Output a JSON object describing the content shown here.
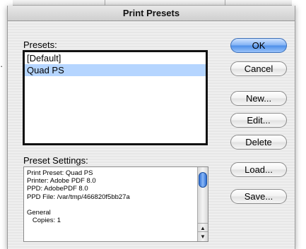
{
  "dialog": {
    "title": "Print Presets"
  },
  "presets": {
    "label": "Presets:",
    "items": [
      {
        "label": "[Default]",
        "selected": false
      },
      {
        "label": "Quad PS",
        "selected": true
      }
    ]
  },
  "settings": {
    "label": "Preset Settings:",
    "lines": [
      "Print Preset: Quad PS",
      "Printer: Adobe PDF 8.0",
      "PPD: AdobePDF 8.0",
      "PPD File: /var/tmp/466820f5bb27a",
      "",
      "General",
      "   Copies: 1"
    ]
  },
  "buttons": {
    "ok": "OK",
    "cancel": "Cancel",
    "new": "New...",
    "edit": "Edit...",
    "delete": "Delete",
    "load": "Load...",
    "save": "Save..."
  },
  "background": {
    "dots": "· ·"
  },
  "icons": {
    "scroll_up": "up-arrow-icon",
    "scroll_down": "down-arrow-icon"
  },
  "colors": {
    "selection": "#b5d5ff",
    "default_button": "#4c8ee8"
  }
}
